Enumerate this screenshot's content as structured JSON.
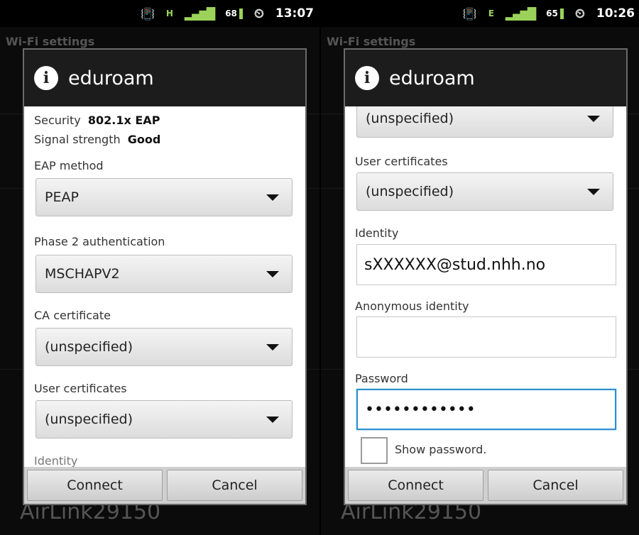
{
  "left": {
    "status": {
      "battery": "68",
      "clock": "13:07",
      "net": "H"
    },
    "background": {
      "title": "Wi-Fi settings",
      "footer": "AirLink29150"
    },
    "dialog": {
      "title": "eduroam",
      "security_label": "Security",
      "security_value": "802.1x EAP",
      "signal_label": "Signal strength",
      "signal_value": "Good",
      "eap_label": "EAP method",
      "eap_value": "PEAP",
      "phase2_label": "Phase 2 authentication",
      "phase2_value": "MSCHAPV2",
      "ca_label": "CA certificate",
      "ca_value": "(unspecified)",
      "user_cert_label": "User certificates",
      "user_cert_value": "(unspecified)",
      "identity_label": "Identity",
      "connect": "Connect",
      "cancel": "Cancel"
    }
  },
  "right": {
    "status": {
      "battery": "65",
      "clock": "10:26",
      "net": "E"
    },
    "background": {
      "title": "Wi-Fi settings",
      "footer": "AirLink29150"
    },
    "dialog": {
      "title": "eduroam",
      "top_value": "(unspecified)",
      "user_cert_label": "User certificates",
      "user_cert_value": "(unspecified)",
      "identity_label": "Identity",
      "identity_value": "sXXXXXX@stud.nhh.no",
      "anon_label": "Anonymous identity",
      "anon_value": "",
      "password_label": "Password",
      "password_value": "••••••••••••",
      "show_password": "Show password.",
      "connect": "Connect",
      "cancel": "Cancel"
    }
  }
}
